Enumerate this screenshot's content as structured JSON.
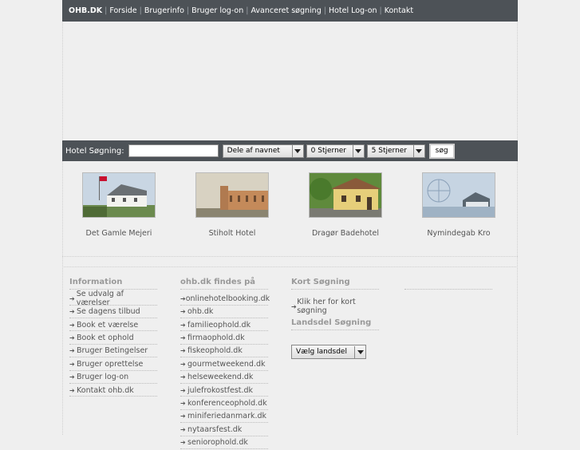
{
  "nav": {
    "brand": "OHB.DK",
    "items": [
      "Forside",
      "Brugerinfo",
      "Bruger log-on",
      "Avanceret søgning",
      "Hotel Log-on",
      "Kontakt"
    ]
  },
  "search": {
    "label": "Hotel Søgning:",
    "text_value": "",
    "match_select": "Dele af navnet",
    "min_stars": "0 Stjerner",
    "max_stars": "5 Stjerner",
    "button": "søg"
  },
  "hotels": [
    "Det Gamle Mejeri",
    "Stiholt Hotel",
    "Dragør Badehotel",
    "Nymindegab Kro"
  ],
  "footer": {
    "info_title": "Information",
    "info_items": [
      "Se udvalg af værelser",
      "Se dagens tilbud",
      "Book et værelse",
      "Book et ophold",
      "Bruger Betingelser",
      "Bruger oprettelse",
      "Bruger log-on",
      "Kontakt ohb.dk"
    ],
    "sites_title": "ohb.dk findes på",
    "sites_items": [
      "onlinehotelbooking.dk",
      "ohb.dk",
      "familieophold.dk",
      "firmaophold.dk",
      "fiskeophold.dk",
      "gourmetweekend.dk",
      "helseweekend.dk",
      "julefrokostfest.dk",
      "konferenceophold.dk",
      "miniferiedanmark.dk",
      "nytaarsfest.dk",
      "seniorophold.dk"
    ],
    "kort_title": "Kort Søgning",
    "kort_link": "Klik her for kort søgning",
    "landsdel_title": "Landsdel Søgning",
    "landsdel_select": "Vælg landsdel"
  },
  "colors": {
    "bar": "#4d5257",
    "page": "#efefef"
  }
}
